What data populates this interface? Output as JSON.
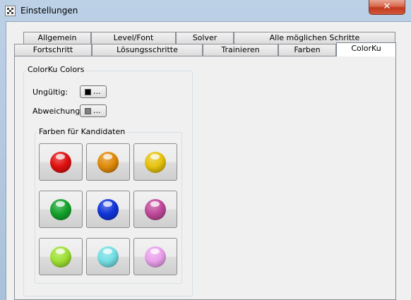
{
  "window": {
    "title": "Einstellungen",
    "close_label": "✕"
  },
  "tabs": {
    "row1": [
      {
        "label": "Allgemein"
      },
      {
        "label": "Level/Font"
      },
      {
        "label": "Solver"
      },
      {
        "label": "Alle möglichen Schritte"
      }
    ],
    "row2": [
      {
        "label": "Fortschritt"
      },
      {
        "label": "Lösungsschritte"
      },
      {
        "label": "Trainieren"
      },
      {
        "label": "Farben"
      },
      {
        "label": "ColorKu",
        "active": true
      }
    ]
  },
  "colorku": {
    "group_title": "ColorKu Colors",
    "invalid": {
      "label": "Ungültig:",
      "button_text": "...",
      "color": "#000000"
    },
    "deviation": {
      "label": "Abweichung:",
      "button_text": "...",
      "color": "#808080"
    },
    "candidates": {
      "title": "Farben für Kandidaten",
      "colors": [
        {
          "name": "red",
          "hex": "#e01010"
        },
        {
          "name": "orange",
          "hex": "#e08a0a"
        },
        {
          "name": "yellow",
          "hex": "#e6c20e"
        },
        {
          "name": "green",
          "hex": "#13a22a"
        },
        {
          "name": "blue",
          "hex": "#1035d8"
        },
        {
          "name": "magenta",
          "hex": "#c0489a"
        },
        {
          "name": "light-green",
          "hex": "#9ee033"
        },
        {
          "name": "cyan",
          "hex": "#74dee4"
        },
        {
          "name": "pink",
          "hex": "#eaa0ea"
        }
      ]
    }
  }
}
